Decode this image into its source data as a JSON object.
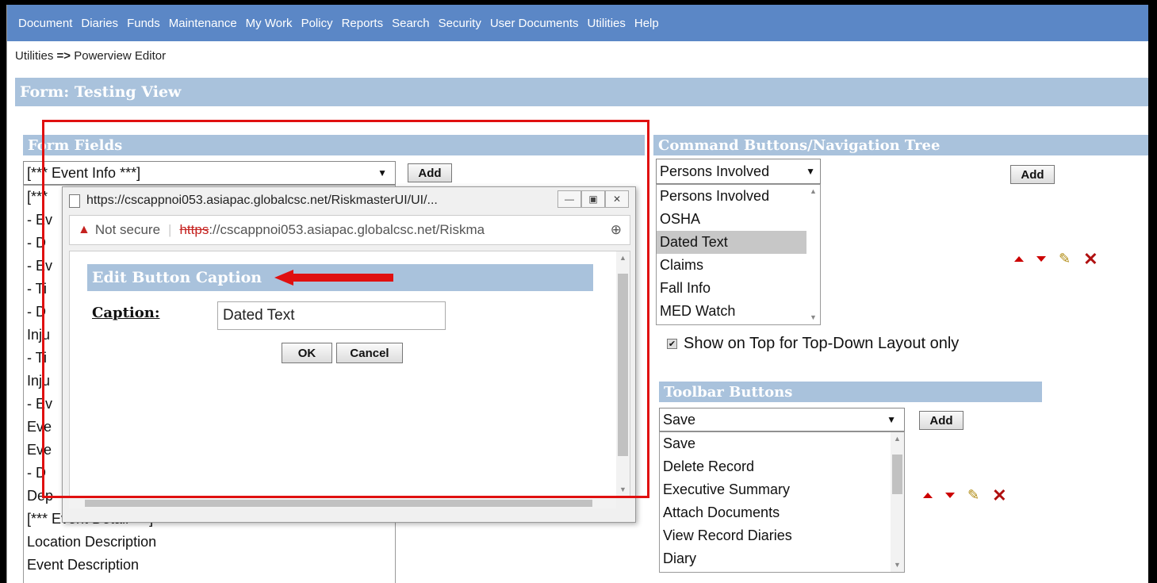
{
  "menu": [
    "Document",
    "Diaries",
    "Funds",
    "Maintenance",
    "My Work",
    "Policy",
    "Reports",
    "Search",
    "Security",
    "User Documents",
    "Utilities",
    "Help"
  ],
  "breadcrumb": {
    "parent": "Utilities",
    "sep": "=>",
    "current": "Powerview Editor"
  },
  "form_title": "Form: Testing View",
  "form_fields": {
    "header": "Form Fields",
    "selected": "[*** Event Info ***]",
    "add_label": "Add",
    "list_visible_prefixes": [
      "[***",
      "- Ev",
      "- D",
      "- Ev",
      "- Ti",
      "- D",
      "Inju",
      "- Ti",
      "Inju",
      "- Ev",
      "Eve",
      "Eve",
      "- D",
      "Dep"
    ],
    "list_items": [
      "[*** Event Detail ***]",
      "Location Description",
      "Event Description"
    ]
  },
  "command_buttons": {
    "header": "Command Buttons/Navigation Tree",
    "selected": "Persons Involved",
    "add_label": "Add",
    "items": [
      "Persons Involved",
      "OSHA",
      "Dated Text",
      "Claims",
      "Fall Info",
      "MED Watch"
    ],
    "selected_index": 2,
    "checkbox_label": "Show on Top for Top-Down Layout only",
    "checkbox_checked": true
  },
  "toolbar_buttons": {
    "header": "Toolbar Buttons",
    "selected": "Save",
    "add_label": "Add",
    "items": [
      "Save",
      "Delete Record",
      "Executive Summary",
      "Attach Documents",
      "View Record Diaries",
      "Diary"
    ]
  },
  "popup": {
    "window_title": "https://cscappnoi053.asiapac.globalcsc.net/RiskmasterUI/UI/...",
    "not_secure": "Not secure",
    "url_scheme": "https",
    "url_rest": "://cscappnoi053.asiapac.globalcsc.net/Riskma",
    "section_title": "Edit Button Caption",
    "caption_label": "Caption:",
    "caption_value": "Dated Text",
    "ok_label": "OK",
    "cancel_label": "Cancel"
  },
  "colors": {
    "menu_bg": "#5b87c6",
    "section_bg": "#a9c2dc",
    "highlight_red": "#e01010"
  }
}
